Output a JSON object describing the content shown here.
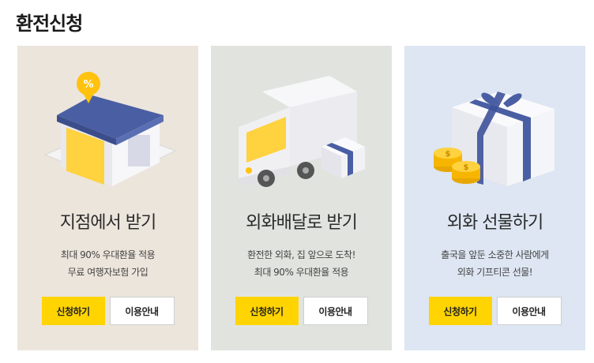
{
  "page": {
    "title": "환전신청"
  },
  "cards": [
    {
      "title": "지점에서 받기",
      "desc": [
        "최대 90% 우대환율 적용",
        "무료 여행자보험 가입"
      ],
      "apply_label": "신청하기",
      "guide_label": "이용안내",
      "icon": "bank-building-icon",
      "background": "#ece5dc"
    },
    {
      "title": "외화배달로 받기",
      "desc": [
        "환전한 외화, 집 앞으로 도착!",
        "최대 90% 우대환율 적용"
      ],
      "apply_label": "신청하기",
      "guide_label": "이용안내",
      "icon": "delivery-truck-icon",
      "background": "#e1e4de"
    },
    {
      "title": "외화 선물하기",
      "desc": [
        "출국을 앞둔 소중한 사람에게",
        "외화 기프티콘 선물!"
      ],
      "apply_label": "신청하기",
      "guide_label": "이용안내",
      "icon": "gift-box-icon",
      "background": "#dde6f2"
    }
  ],
  "colors": {
    "accent": "#ffd400",
    "navy": "#4a5fa3"
  }
}
